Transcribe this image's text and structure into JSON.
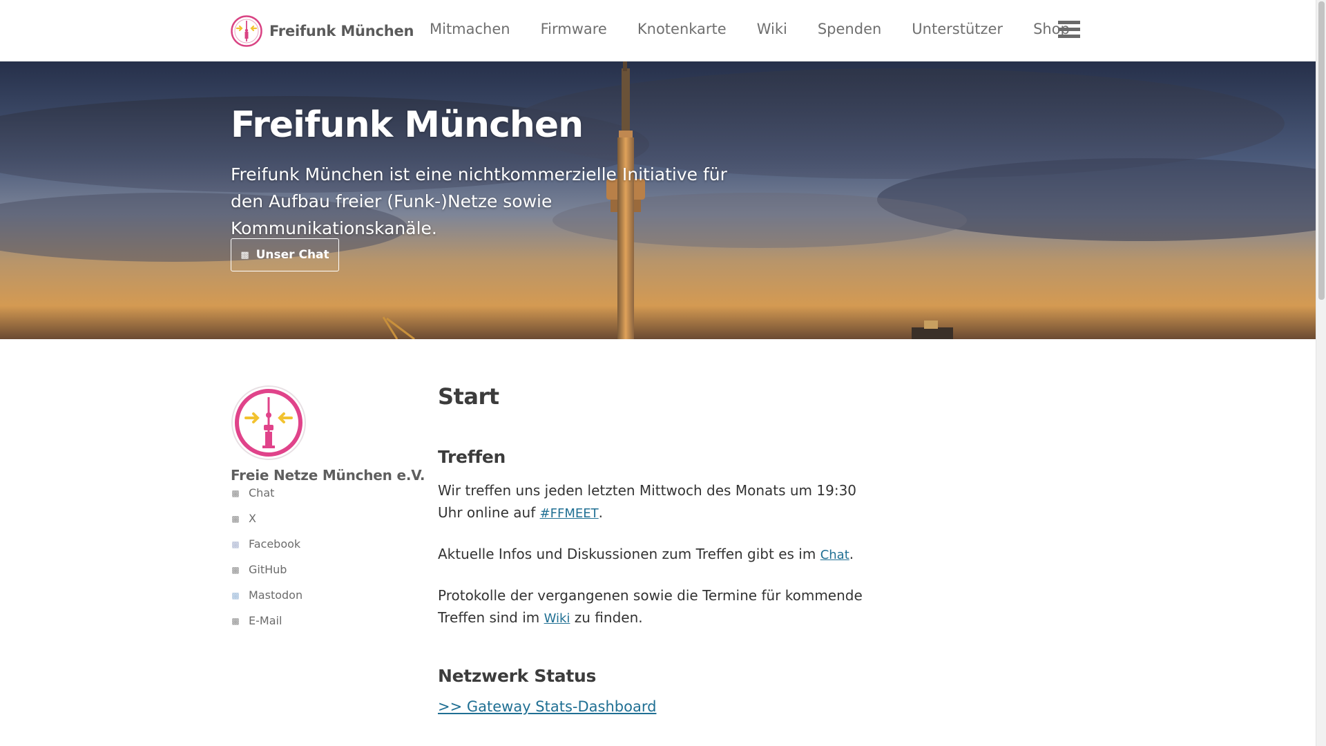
{
  "header": {
    "brand_name": "Freifunk München",
    "nav": [
      "Mitmachen",
      "Firmware",
      "Knotenkarte",
      "Wiki",
      "Spenden",
      "Unterstützer",
      "Shop"
    ]
  },
  "hero": {
    "title": "Freifunk München",
    "text": "Freifunk München ist eine nichtkommerzielle Initiative für den Aufbau freier (Funk-)Netze sowie Kommunikationskanäle.",
    "button_label": "Unser Chat",
    "button_icon": "chat-icon"
  },
  "sidebar": {
    "org_name": "Freie Netze München e.V.",
    "links": [
      {
        "label": "Chat",
        "icon": "chat-icon"
      },
      {
        "label": "X",
        "icon": "x-icon"
      },
      {
        "label": "Facebook",
        "icon": "facebook-icon"
      },
      {
        "label": "GitHub",
        "icon": "github-icon"
      },
      {
        "label": "Mastodon",
        "icon": "mastodon-icon"
      },
      {
        "label": "E-Mail",
        "icon": "email-icon"
      }
    ]
  },
  "main": {
    "title": "Start",
    "treffen": {
      "heading": "Treffen",
      "p1_before": "Wir treffen uns jeden letzten Mittwoch des Monats um 19:30 Uhr online auf ",
      "p1_link": "#FFMEET",
      "p1_after": ".",
      "p2_before": "Aktuelle Infos und Diskussionen zum Treffen gibt es im ",
      "p2_link": "Chat",
      "p2_after": ".",
      "p3_before": "Protokolle der vergangenen sowie die Termine für kommende Treffen sind im ",
      "p3_link": "Wiki",
      "p3_after": " zu finden."
    },
    "status": {
      "heading": "Netzwerk Status",
      "link": ">> Gateway Stats-Dashboard"
    }
  },
  "colors": {
    "brand_pink": "#e0438a",
    "brand_yellow": "#f2c230",
    "link": "#1f6f93",
    "nav_text": "#6f6f6f"
  }
}
